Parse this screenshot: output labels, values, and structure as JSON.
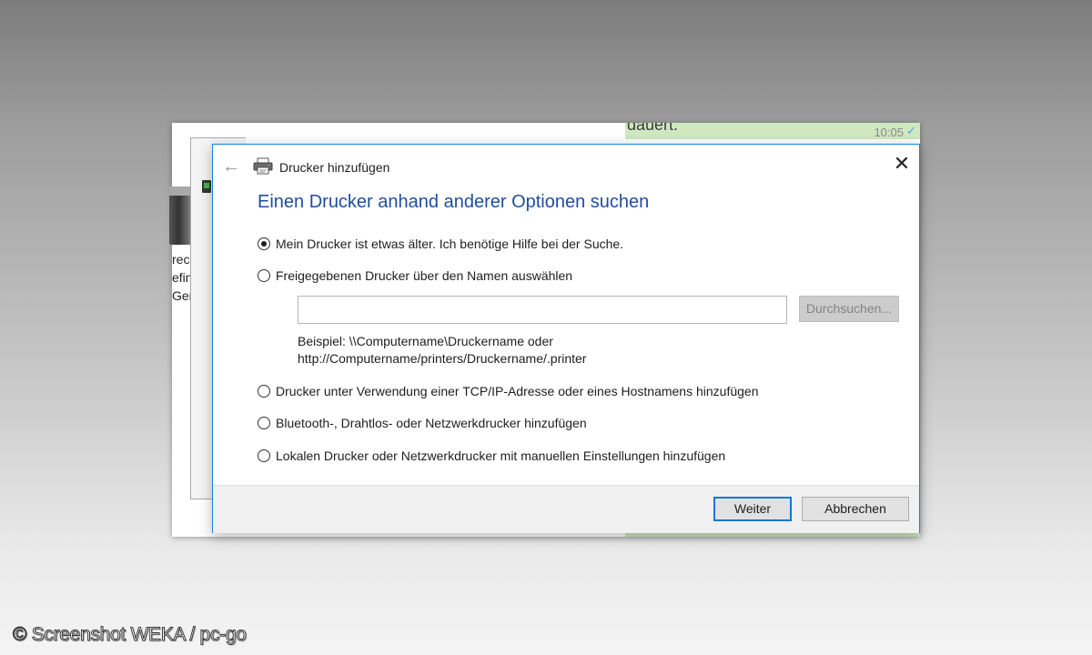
{
  "background_window": {
    "chat_text": "dauert.",
    "chat_time": "10:05",
    "chat_check_icon": "check-icon",
    "left_partial_text": [
      "rech",
      "efin",
      "Ger"
    ]
  },
  "dialog": {
    "title": "Drucker hinzufügen",
    "back_icon": "back-arrow-icon",
    "printer_icon": "printer-icon",
    "close_icon": "close-icon",
    "close_glyph": "✕",
    "heading": "Einen Drucker anhand anderer Optionen suchen",
    "options": [
      {
        "label": "Mein Drucker ist etwas älter. Ich benötige Hilfe bei der Suche.",
        "checked": true
      },
      {
        "label": "Freigegebenen Drucker über den Namen auswählen",
        "checked": false
      },
      {
        "label": "Drucker unter Verwendung einer TCP/IP-Adresse oder eines Hostnamens hinzufügen",
        "checked": false
      },
      {
        "label": "Bluetooth-, Drahtlos- oder Netzwerkdrucker hinzufügen",
        "checked": false
      },
      {
        "label": "Lokalen Drucker oder Netzwerkdrucker mit manuellen Einstellungen hinzufügen",
        "checked": false
      }
    ],
    "name_input": {
      "value": "",
      "placeholder": ""
    },
    "browse_button": "Durchsuchen...",
    "example_line1": "Beispiel: \\\\Computername\\Druckername oder",
    "example_line2": "http://Computername/printers/Druckername/.printer",
    "next_button": "Weiter",
    "cancel_button": "Abbrechen"
  },
  "watermark": "© Screenshot WEKA / pc-go",
  "colors": {
    "accent": "#0078d7",
    "heading": "#1f4e9c",
    "dialog_border": "#1883d7",
    "chat_bubble": "#cfe8c0"
  }
}
